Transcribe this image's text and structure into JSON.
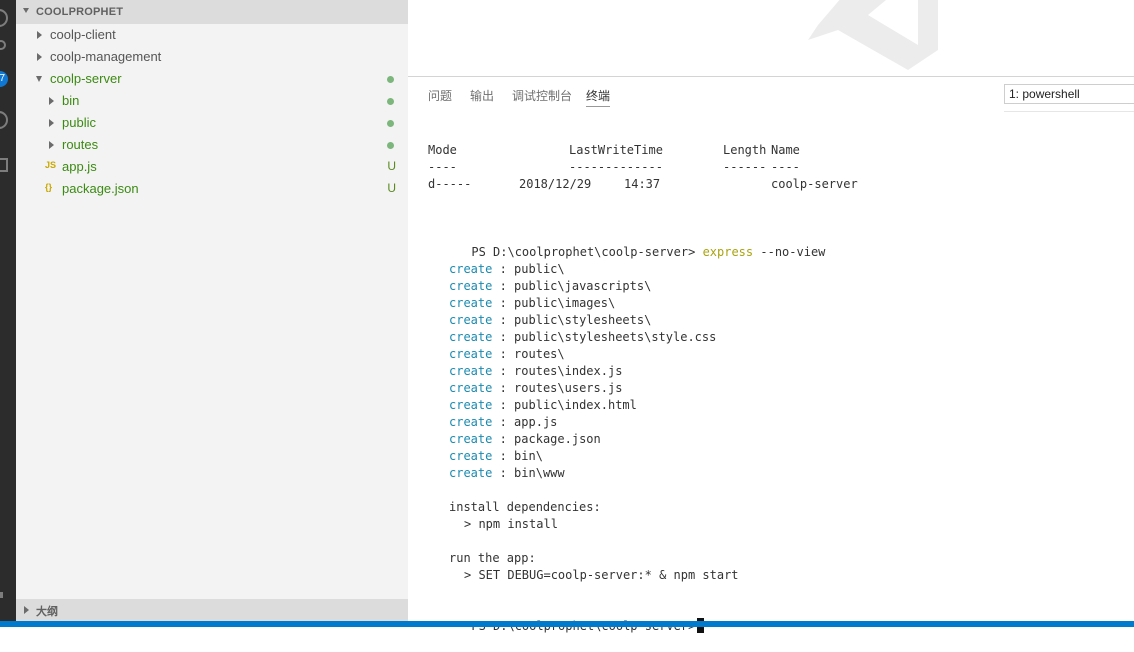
{
  "activity_bar": {
    "badge_count": "7"
  },
  "explorer": {
    "section_title": "COOLPROPHET",
    "items": [
      {
        "label": "coolp-client"
      },
      {
        "label": "coolp-management"
      },
      {
        "label": "coolp-server"
      },
      {
        "label": "bin"
      },
      {
        "label": "public"
      },
      {
        "label": "routes"
      },
      {
        "label": "app.js",
        "icon_text": "JS",
        "status": "U"
      },
      {
        "label": "package.json",
        "icon_text": "{}",
        "status": "U"
      }
    ],
    "outline_title": "大纲"
  },
  "panel": {
    "tabs": [
      "问题",
      "输出",
      "调试控制台",
      "终端"
    ],
    "active_tab": "终端",
    "terminal_selector": "1: powershell"
  },
  "terminal": {
    "header": [
      "Mode",
      "LastWriteTime",
      "Length",
      "Name"
    ],
    "header_dashes": [
      "----",
      "-------------",
      "------",
      "----"
    ],
    "dir_row": {
      "mode": "d-----",
      "date": "2018/12/29",
      "time": "14:37",
      "name": "coolp-server"
    },
    "prompt": "PS D:\\coolprophet\\coolp-server>",
    "command": "express",
    "command_args": "--no-view",
    "create_keyword": "create",
    "created_paths": [
      "public\\",
      "public\\javascripts\\",
      "public\\images\\",
      "public\\stylesheets\\",
      "public\\stylesheets\\style.css",
      "routes\\",
      "routes\\index.js",
      "routes\\users.js",
      "public\\index.html",
      "app.js",
      "package.json",
      "bin\\",
      "bin\\www"
    ],
    "install_label": "install dependencies:",
    "install_cmd": "> npm install",
    "run_label": "run the app:",
    "run_cmd": "> SET DEBUG=coolp-server:* & npm start"
  },
  "colors": {
    "activity_bar": "#2c2c2c",
    "sidebar": "#f3f3f3",
    "git_added": "#3c8a13",
    "create_keyword": "#1a8ab0",
    "command": "#aaa30f",
    "status_bar": "#007acc"
  }
}
